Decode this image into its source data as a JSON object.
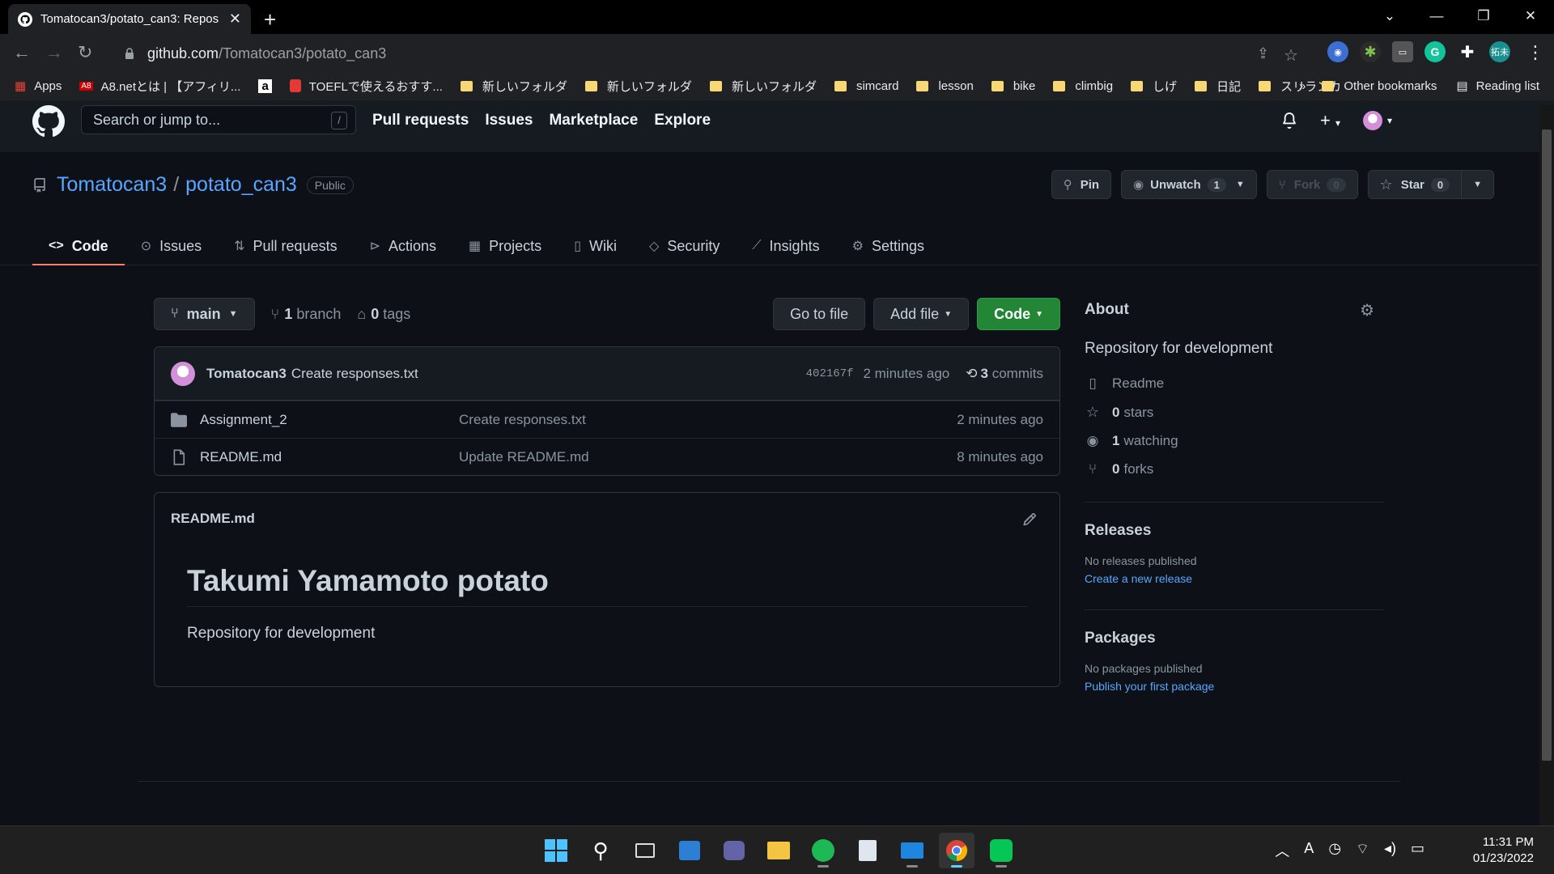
{
  "browser": {
    "tab_title": "Tomatocan3/potato_can3: Repos",
    "url_host": "github.com",
    "url_path": "/Tomatocan3/potato_can3",
    "profile_badge": "拓未",
    "bookmarks": [
      "Apps",
      "A8.netとは | 【アフィリ...",
      "",
      "TOEFLで使えるおすす...",
      "新しいフォルダ",
      "新しいフォルダ",
      "新しいフォルダ",
      "simcard",
      "lesson",
      "bike",
      "climbig",
      "しげ",
      "日記",
      "スリランカ"
    ],
    "overflow": "»",
    "other_bookmarks": "Other bookmarks",
    "reading_list": "Reading list"
  },
  "github_header": {
    "search_placeholder": "Search or jump to...",
    "search_key": "/",
    "nav": [
      "Pull requests",
      "Issues",
      "Marketplace",
      "Explore"
    ]
  },
  "repo": {
    "owner": "Tomatocan3",
    "separator": "/",
    "name": "potato_can3",
    "visibility": "Public",
    "pin_label": "Pin",
    "unwatch_label": "Unwatch",
    "watch_count": "1",
    "fork_label": "Fork",
    "fork_count": "0",
    "star_label": "Star",
    "star_count": "0",
    "tabs": [
      "Code",
      "Issues",
      "Pull requests",
      "Actions",
      "Projects",
      "Wiki",
      "Security",
      "Insights",
      "Settings"
    ]
  },
  "file_nav": {
    "branch": "main",
    "branch_count": "1",
    "branch_label": "branch",
    "tag_count": "0",
    "tag_label": "tags",
    "go_to_file": "Go to file",
    "add_file": "Add file",
    "code": "Code"
  },
  "latest_commit": {
    "author": "Tomatocan3",
    "message": "Create responses.txt",
    "sha": "402167f",
    "age": "2 minutes ago",
    "commit_count": "3",
    "commit_label": "commits"
  },
  "files": [
    {
      "name": "Assignment_2",
      "type": "folder",
      "message": "Create responses.txt",
      "age": "2 minutes ago"
    },
    {
      "name": "README.md",
      "type": "file",
      "message": "Update README.md",
      "age": "8 minutes ago"
    }
  ],
  "readme": {
    "filename": "README.md",
    "heading": "Takumi Yamamoto potato",
    "body": "Repository for development"
  },
  "sidebar": {
    "about_title": "About",
    "description": "Repository for development",
    "readme_label": "Readme",
    "stars_count": "0",
    "stars_label": "stars",
    "watching_count": "1",
    "watching_label": "watching",
    "forks_count": "0",
    "forks_label": "forks",
    "releases_title": "Releases",
    "releases_none": "No releases published",
    "releases_link": "Create a new release",
    "packages_title": "Packages",
    "packages_none": "No packages published",
    "packages_link": "Publish your first package"
  },
  "taskbar": {
    "time": "11:31 PM",
    "date": "01/23/2022"
  },
  "colors": {
    "accent_blue": "#58a6ff",
    "green_button": "#238636",
    "active_tab_underline": "#f78166",
    "background": "#0d1117"
  }
}
